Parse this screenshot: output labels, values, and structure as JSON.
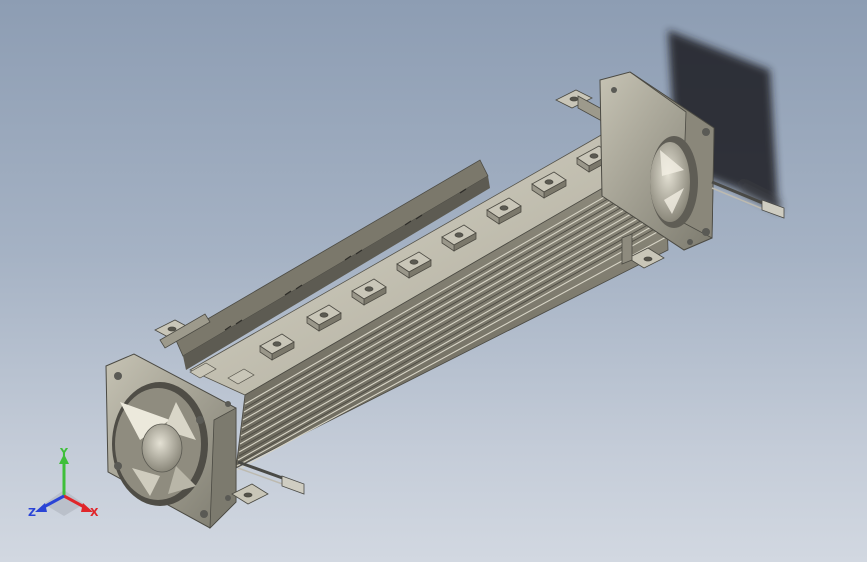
{
  "viewport": {
    "background_top": "#8d9db3",
    "background_bottom": "#d2d8e1",
    "model_colors": {
      "sheet_metal": "#b9b6a6",
      "sheet_dark": "#6f6c60",
      "fan_frame": "#a9a596",
      "screw": "#5a5a55",
      "shadow": "#1c1d22"
    }
  },
  "triad": {
    "x_label": "X",
    "y_label": "Y",
    "z_label": "Z",
    "x_color": "#e0262a",
    "y_color": "#3fbf3a",
    "z_color": "#2a44d6"
  }
}
